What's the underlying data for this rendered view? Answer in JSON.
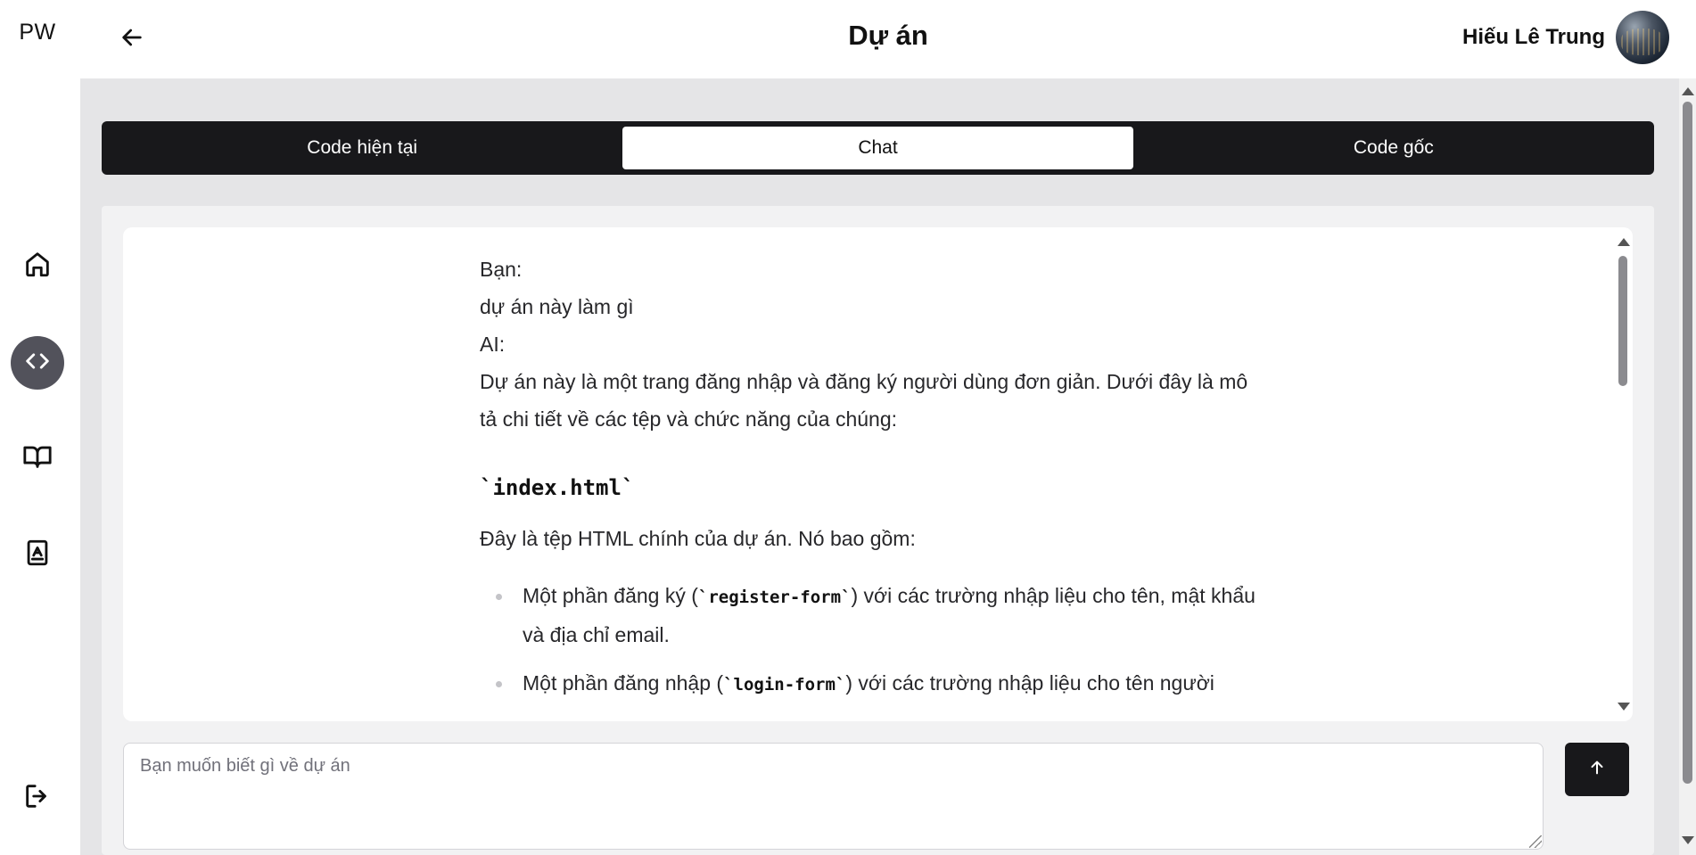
{
  "sidebar": {
    "logo": "PW",
    "items": [
      {
        "name": "home",
        "icon": "home-icon",
        "active": false
      },
      {
        "name": "projects",
        "icon": "code-icon",
        "active": true
      },
      {
        "name": "docs",
        "icon": "book-open-icon",
        "active": false
      },
      {
        "name": "contacts",
        "icon": "contact-book-icon",
        "active": false
      }
    ],
    "logout_icon": "logout-icon"
  },
  "header": {
    "back_icon": "arrow-left-icon",
    "title": "Dự án",
    "user_name": "Hiếu Lê Trung"
  },
  "tabs": [
    {
      "label": "Code hiện tại",
      "active": false
    },
    {
      "label": "Chat",
      "active": true
    },
    {
      "label": "Code gốc",
      "active": false
    }
  ],
  "chat": {
    "user_label": "Bạn:",
    "user_message": "dự án này làm gì",
    "ai_label": "AI:",
    "ai_intro": "Dự án này là một trang đăng nhập và đăng ký người dùng đơn giản. Dưới đây là mô tả chi tiết về các tệp và chức năng của chúng:",
    "file_heading": "`index.html`",
    "file_description": "Đây là tệp HTML chính của dự án. Nó bao gồm:",
    "list": [
      {
        "before": "Một phần đăng ký (",
        "code": "`register-form`",
        "after": ") với các trường nhập liệu cho tên, mật khẩu và địa chỉ email."
      },
      {
        "before": "Một phần đăng nhập (",
        "code": "`login-form`",
        "after": ") với các trường nhập liệu cho tên người"
      }
    ]
  },
  "input": {
    "placeholder": "Bạn muốn biết gì về dự án",
    "value": ""
  },
  "send_icon": "arrow-up-icon",
  "colors": {
    "dark": "#18181b",
    "background": "#e5e5e7",
    "active_nav": "#52525b"
  }
}
